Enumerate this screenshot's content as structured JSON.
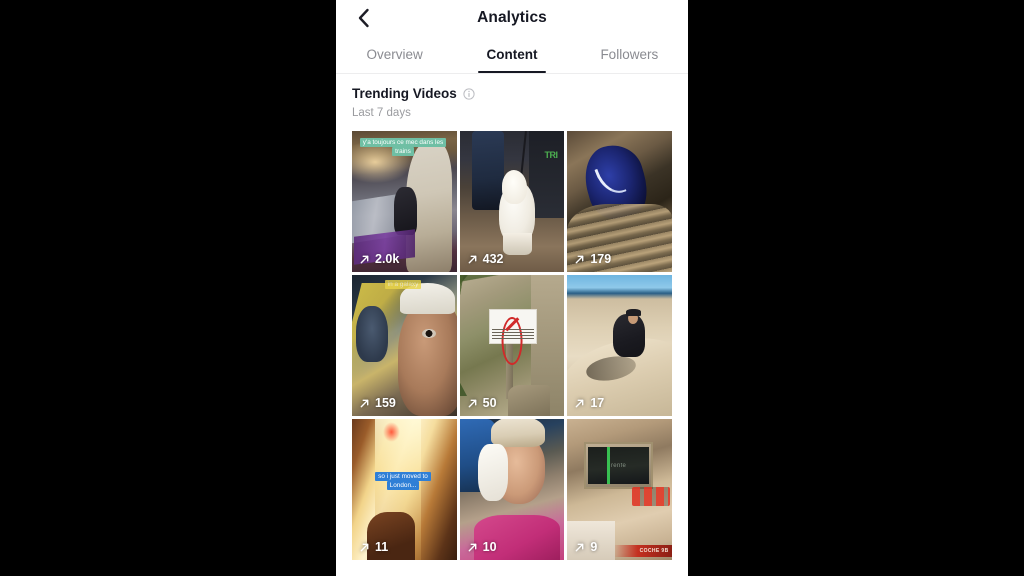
{
  "header": {
    "back_icon": "chevron-left-icon",
    "title": "Analytics"
  },
  "tabs": [
    {
      "label": "Overview",
      "active": false
    },
    {
      "label": "Content",
      "active": true
    },
    {
      "label": "Followers",
      "active": false
    }
  ],
  "section": {
    "title": "Trending Videos",
    "info_icon": "info-circle-icon",
    "subtitle": "Last 7 days"
  },
  "videos": [
    {
      "views": "2.0k",
      "views_icon": "arrow-up-right-icon",
      "caption": "y'a toujours ce mec dans les trains",
      "caption_color": "#6fbfa4"
    },
    {
      "views": "432",
      "views_icon": "arrow-up-right-icon",
      "caption": "",
      "caption_color": ""
    },
    {
      "views": "179",
      "views_icon": "arrow-up-right-icon",
      "caption": "",
      "caption_color": ""
    },
    {
      "views": "159",
      "views_icon": "arrow-up-right-icon",
      "caption": "in a galaxy",
      "caption_color": "#e8d44a"
    },
    {
      "views": "50",
      "views_icon": "arrow-up-right-icon",
      "caption": "",
      "caption_color": ""
    },
    {
      "views": "17",
      "views_icon": "arrow-up-right-icon",
      "caption": "",
      "caption_color": ""
    },
    {
      "views": "11",
      "views_icon": "arrow-up-right-icon",
      "caption": "so i just moved to London...",
      "caption_color": "#2f7fd6"
    },
    {
      "views": "10",
      "views_icon": "arrow-up-right-icon",
      "caption": "",
      "caption_color": ""
    },
    {
      "views": "9",
      "views_icon": "arrow-up-right-icon",
      "caption": "",
      "caption_color": ""
    }
  ],
  "artwork_text": {
    "dog_sign": "TRI",
    "renfe_screen": "renfe",
    "renfe_strip": "COCHE 9B"
  },
  "colors": {
    "text_primary": "#161823",
    "text_muted": "#8a8b91",
    "tab_indicator": "#161823",
    "screen_bg": "#ffffff",
    "letterbox": "#000000"
  }
}
